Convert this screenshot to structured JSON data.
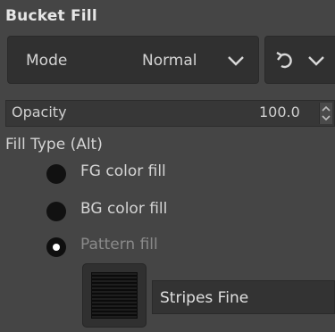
{
  "title": "Bucket Fill",
  "mode": {
    "label": "Mode",
    "value": "Normal",
    "chevron_icon": "chevron-down-icon",
    "reset_icon": "reset-icon"
  },
  "opacity": {
    "label": "Opacity",
    "value": "100.0"
  },
  "fill_type": {
    "label": "Fill Type  (Alt)",
    "options": [
      {
        "label": "FG color fill",
        "checked": false
      },
      {
        "label": "BG color fill",
        "checked": false
      },
      {
        "label": "Pattern fill",
        "checked": true
      }
    ]
  },
  "pattern": {
    "name": "Stripes Fine"
  }
}
